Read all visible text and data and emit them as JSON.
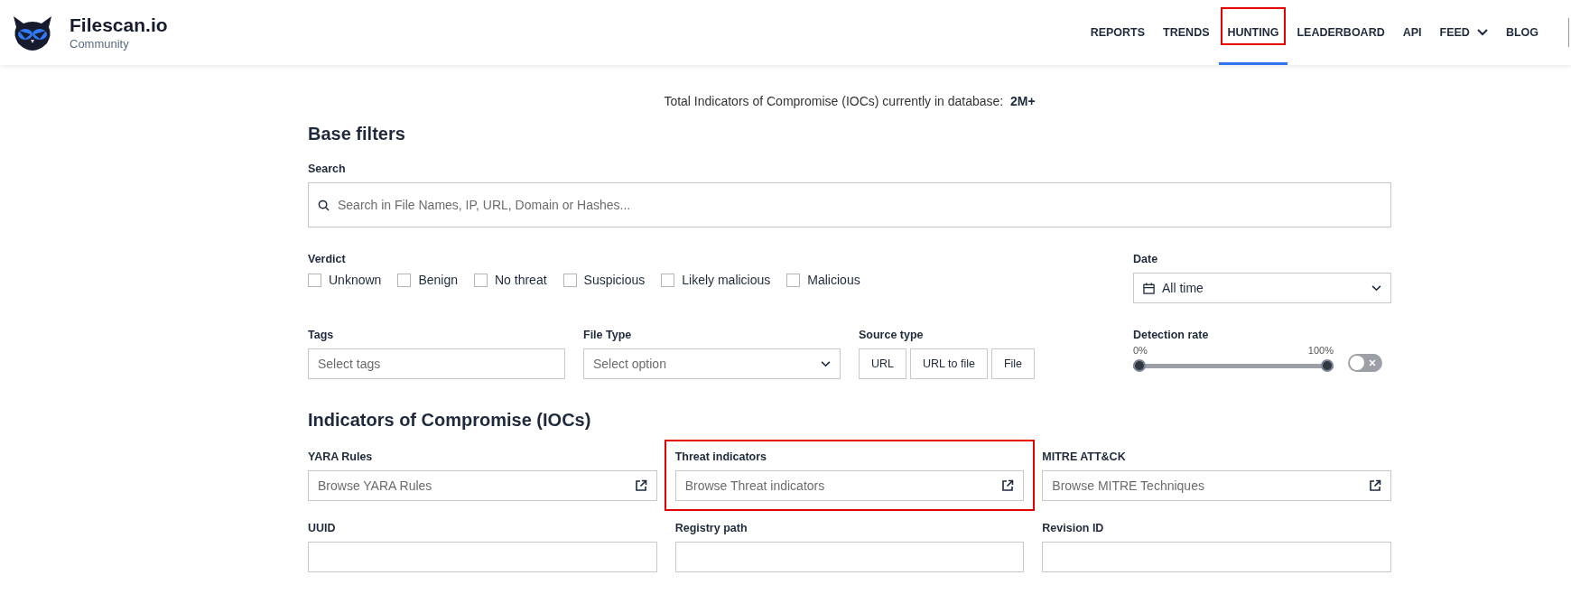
{
  "brand": {
    "name": "Filescan.io",
    "subtitle": "Community"
  },
  "nav": [
    {
      "label": "REPORTS",
      "selected": false,
      "highlighted": false,
      "dropdown": false
    },
    {
      "label": "TRENDS",
      "selected": false,
      "highlighted": false,
      "dropdown": false
    },
    {
      "label": "HUNTING",
      "selected": true,
      "highlighted": true,
      "dropdown": false
    },
    {
      "label": "LEADERBOARD",
      "selected": false,
      "highlighted": false,
      "dropdown": false
    },
    {
      "label": "API",
      "selected": false,
      "highlighted": false,
      "dropdown": false
    },
    {
      "label": "FEED",
      "selected": false,
      "highlighted": false,
      "dropdown": true
    },
    {
      "label": "BLOG",
      "selected": false,
      "highlighted": false,
      "dropdown": false
    }
  ],
  "summary": {
    "text": "Total Indicators of Compromise (IOCs) currently in database:",
    "value": "2M+"
  },
  "base_filters": {
    "title": "Base filters",
    "search": {
      "label": "Search",
      "placeholder": "Search in File Names, IP, URL, Domain or Hashes..."
    },
    "verdict": {
      "label": "Verdict",
      "options": [
        {
          "label": "Unknown",
          "checked": false
        },
        {
          "label": "Benign",
          "checked": false
        },
        {
          "label": "No threat",
          "checked": false
        },
        {
          "label": "Suspicious",
          "checked": false
        },
        {
          "label": "Likely malicious",
          "checked": false
        },
        {
          "label": "Malicious",
          "checked": false
        }
      ]
    },
    "date": {
      "label": "Date",
      "value": "All time"
    },
    "tags": {
      "label": "Tags",
      "placeholder": "Select tags"
    },
    "file_type": {
      "label": "File Type",
      "placeholder": "Select option"
    },
    "source_type": {
      "label": "Source type",
      "options": [
        {
          "label": "URL",
          "selected": false
        },
        {
          "label": "URL to file",
          "selected": false
        },
        {
          "label": "File",
          "selected": false
        }
      ]
    },
    "detection_rate": {
      "label": "Detection rate",
      "min_label": "0%",
      "max_label": "100%",
      "thumbs": [
        {
          "level": 0
        },
        {
          "level": 1
        }
      ],
      "toggle": {
        "on": false
      }
    }
  },
  "iocs": {
    "title": "Indicators of Compromise (IOCs)",
    "fields": [
      {
        "label": "YARA Rules",
        "placeholder": "Browse YARA Rules",
        "kind": "browse",
        "highlighted": false
      },
      {
        "label": "Threat indicators",
        "placeholder": "Browse Threat indicators",
        "kind": "browse",
        "highlighted": true
      },
      {
        "label": "MITRE ATT&CK",
        "placeholder": "Browse MITRE Techniques",
        "kind": "browse",
        "highlighted": false
      },
      {
        "label": "UUID",
        "kind": "text",
        "highlighted": false
      },
      {
        "label": "Registry path",
        "kind": "text",
        "highlighted": false
      },
      {
        "label": "Revision ID",
        "kind": "text",
        "highlighted": false
      }
    ]
  }
}
